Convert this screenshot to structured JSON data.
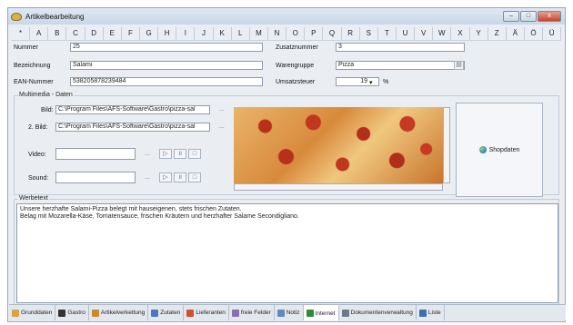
{
  "window": {
    "title": "Artikelbearbeitung",
    "buttons": [
      "–",
      "□",
      "x"
    ]
  },
  "alphabet": [
    "*",
    "A",
    "B",
    "C",
    "D",
    "E",
    "F",
    "G",
    "H",
    "I",
    "J",
    "K",
    "L",
    "M",
    "N",
    "O",
    "P",
    "Q",
    "R",
    "S",
    "T",
    "U",
    "V",
    "W",
    "X",
    "Y",
    "Z",
    "Ä",
    "Ö",
    "Ü"
  ],
  "fields": {
    "nummer": {
      "label": "Nummer",
      "value": "25"
    },
    "bezeichnung": {
      "label": "Bezeichnung",
      "value": "Salami"
    },
    "ean": {
      "label": "EAN-Nummer",
      "value": "538205878239484"
    },
    "zusatznummer": {
      "label": "Zusatznummer",
      "value": "3"
    },
    "warengruppe": {
      "label": "Warengruppe",
      "value": "Pizza"
    },
    "umsatzsteuer": {
      "label": "Umsatzsteuer",
      "value": "19",
      "unit": "%"
    }
  },
  "multimedia": {
    "group_label": "Multimedia - Daten",
    "bild_label": "Bild:",
    "bild_value": "C:\\Program Files\\AFS-Software\\Gastro\\pizza-sal",
    "bild2_label": "2. Bild:",
    "bild2_value": "C:\\Program Files\\AFS-Software\\Gastro\\pizza-sal",
    "video_label": "Video:",
    "sound_label": "Sound:",
    "dots": "...",
    "shop_label": "Shopdaten"
  },
  "werbetext": {
    "group_label": "Werbetext",
    "text": "Unsere herzhafte Salami-Pizza belegt mit hauseigenen, stets frischen Zutaten.\nBelag mit Mozarella-Käse, Tomatensauce, frischen Kräutern und herzhafter Salame Secondigliano."
  },
  "tabs": [
    {
      "label": "Grunddaten",
      "color": "#d9a441"
    },
    {
      "label": "Gastro",
      "color": "#333333"
    },
    {
      "label": "Artikelverkettung",
      "color": "#c98a2a"
    },
    {
      "label": "Zutaten",
      "color": "#4a79c0"
    },
    {
      "label": "Lieferanten",
      "color": "#d05030"
    },
    {
      "label": "freie Felder",
      "color": "#8a6fb0"
    },
    {
      "label": "Notiz",
      "color": "#5d8ac0"
    },
    {
      "label": "Internet",
      "color": "#2f8a3a"
    },
    {
      "label": "Dokumentenverwaltung",
      "color": "#6a7a8a"
    },
    {
      "label": "Liste",
      "color": "#3a6fb0"
    }
  ],
  "active_tab": "Internet"
}
